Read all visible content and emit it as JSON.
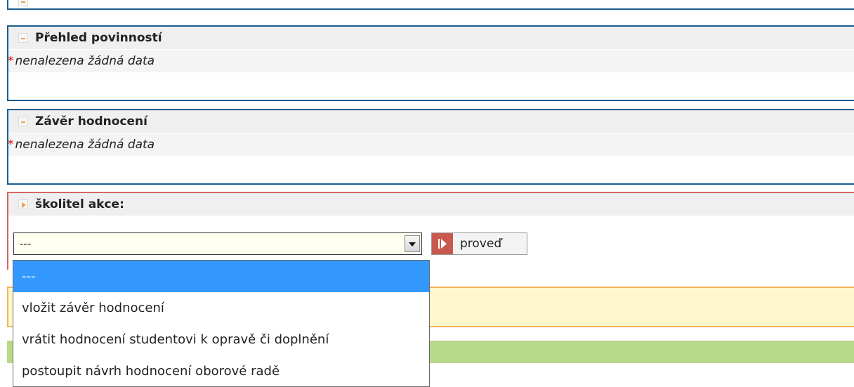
{
  "panels": {
    "obligations": {
      "title": "Přehled povinností",
      "empty_marker": "*",
      "empty_text": "nenalezena žádná data"
    },
    "conclusion": {
      "title": "Závěr hodnocení",
      "empty_marker": "*",
      "empty_text": "nenalezena žádná data"
    },
    "supervisor": {
      "title": "školitel akce:",
      "select_value": "---",
      "run_label": "proveď"
    }
  },
  "dropdown": {
    "options": [
      "---",
      "vložit závěr hodnocení",
      "vrátit hodnocení studentovi k opravě či doplnění",
      "postoupit návrh hodnocení oborové radě"
    ]
  },
  "colors": {
    "panel_border": "#1c5d8f",
    "action_border": "#d46666",
    "selected_option": "#3399ff",
    "yellow_panel": "#fff8cc",
    "green_bar": "#b6d98a"
  }
}
